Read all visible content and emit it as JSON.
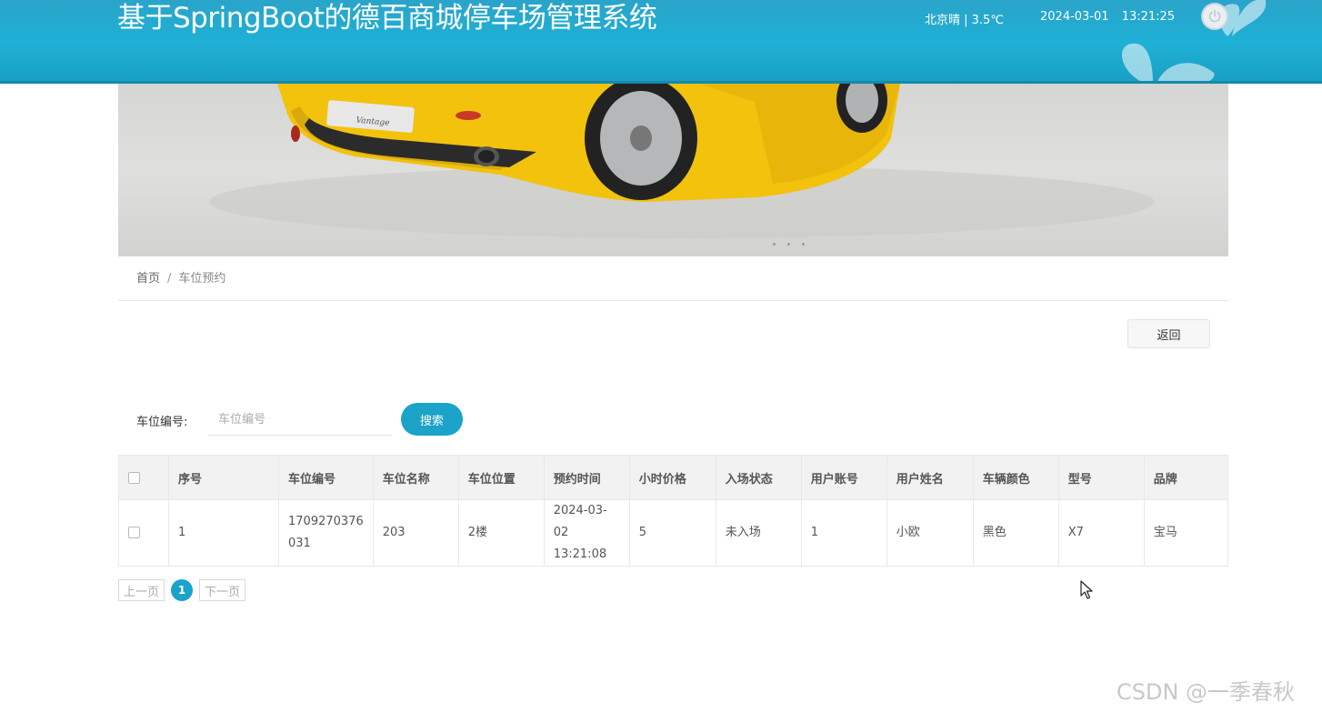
{
  "header": {
    "title": "基于SpringBoot的德百商城停车场管理系统",
    "weather": "北京晴 | 3.5℃",
    "date": "2024-03-01",
    "time": "13:21:25"
  },
  "banner": {
    "slide_count": 3
  },
  "breadcrumb": {
    "home": "首页",
    "separator": "/",
    "current": "车位预约"
  },
  "back_label": "返回",
  "search": {
    "label": "车位编号:",
    "placeholder": "车位编号",
    "button": "搜索"
  },
  "table": {
    "headers": [
      "序号",
      "车位编号",
      "车位名称",
      "车位位置",
      "预约时间",
      "小时价格",
      "入场状态",
      "用户账号",
      "用户姓名",
      "车辆颜色",
      "型号",
      "品牌"
    ],
    "rows": [
      {
        "index": "1",
        "code_line1": "1709270376",
        "code_line2": "031",
        "name": "203",
        "location": "2楼",
        "date": "2024-03-02",
        "time": "13:21:08",
        "price": "5",
        "status": "未入场",
        "account": "1",
        "user": "小欧",
        "color": "黑色",
        "model": "X7",
        "brand": "宝马"
      }
    ]
  },
  "pagination": {
    "prev": "上一页",
    "current": "1",
    "next": "下一页"
  },
  "watermark": "CSDN @一季春秋",
  "colors": {
    "accent": "#1ba3c9",
    "header": "#1fb0d6"
  }
}
